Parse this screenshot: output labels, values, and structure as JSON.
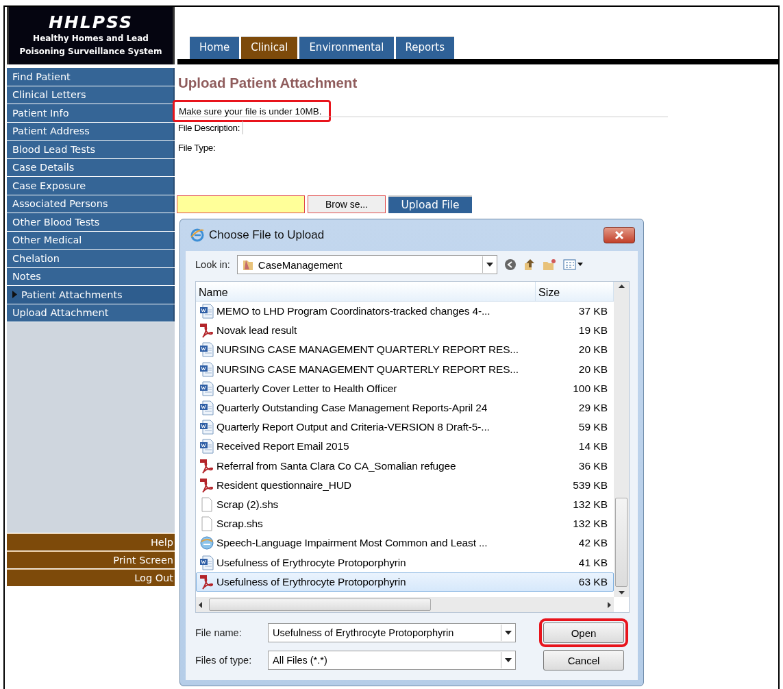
{
  "logo": {
    "title": "HHLPSS",
    "subtitle_1": "Healthy Homes and Lead",
    "subtitle_2": "Poisoning Surveillance System"
  },
  "tabs": [
    {
      "label": "Home",
      "selected": false
    },
    {
      "label": "Clinical",
      "selected": true
    },
    {
      "label": "Environmental",
      "selected": false
    },
    {
      "label": "Reports",
      "selected": false
    }
  ],
  "sidebar": {
    "items": [
      {
        "label": "Find Patient",
        "selected": false
      },
      {
        "label": "Clinical Letters",
        "selected": false
      },
      {
        "label": "Patient Info",
        "selected": false
      },
      {
        "label": "Patient Address",
        "selected": false
      },
      {
        "label": "Blood Lead Tests",
        "selected": false
      },
      {
        "label": "Case Details",
        "selected": false
      },
      {
        "label": "Case Exposure",
        "selected": false
      },
      {
        "label": "Associated Persons",
        "selected": false
      },
      {
        "label": "Other Blood Tests",
        "selected": false
      },
      {
        "label": "Other Medical",
        "selected": false
      },
      {
        "label": "Chelation",
        "selected": false
      },
      {
        "label": "Notes",
        "selected": false
      },
      {
        "label": "Patient Attachments",
        "selected": true
      },
      {
        "label": "Upload Attachment",
        "selected": false
      }
    ],
    "footer_items": [
      "Help",
      "Print Screen",
      "Log Out"
    ]
  },
  "page": {
    "title": "Upload Patient Attachment",
    "note": {
      "text": "Make sure your file is under 10MB.",
      "highlighted": true
    },
    "fields": [
      {
        "label": "File Description:",
        "kind": "input"
      },
      {
        "label": "File Type:",
        "kind": "plain"
      }
    ],
    "browse_button": "Brow se...",
    "upload_button": "Upload File"
  },
  "dialog": {
    "title": "Choose File to Upload",
    "look_in_label": "Look in:",
    "folder": "CaseManagement",
    "columns": [
      "Name",
      "Size"
    ],
    "files": [
      {
        "name": "MEMO to LHD Program Coordinators-tracked changes 4-...",
        "size": "37 KB",
        "kind": "word",
        "selected": false
      },
      {
        "name": "Novak lead result",
        "size": "19 KB",
        "kind": "pdf",
        "selected": false
      },
      {
        "name": "NURSING CASE MANAGEMENT QUARTERLY REPORT RES...",
        "size": "20 KB",
        "kind": "word",
        "selected": false
      },
      {
        "name": "NURSING CASE MANAGEMENT QUARTERLY REPORT RES...",
        "size": "20 KB",
        "kind": "word",
        "selected": false
      },
      {
        "name": "Quarterly Cover Letter to Health Officer",
        "size": "100 KB",
        "kind": "word",
        "selected": false
      },
      {
        "name": "Quarterly Outstanding Case Management Reports-April 24",
        "size": "29 KB",
        "kind": "word",
        "selected": false
      },
      {
        "name": "Quarterly Report Output and Criteria-VERSION 8 Draft-5-...",
        "size": "59 KB",
        "kind": "word",
        "selected": false
      },
      {
        "name": "Received Report Email 2015",
        "size": "14 KB",
        "kind": "word",
        "selected": false
      },
      {
        "name": "Referral from Santa Clara Co CA_Somalian refugee",
        "size": "36 KB",
        "kind": "pdf",
        "selected": false
      },
      {
        "name": "Resident questionnaire_HUD",
        "size": "539 KB",
        "kind": "pdf",
        "selected": false
      },
      {
        "name": "Scrap (2).shs",
        "size": "132 KB",
        "kind": "blank",
        "selected": false
      },
      {
        "name": "Scrap.shs",
        "size": "132 KB",
        "kind": "blank",
        "selected": false
      },
      {
        "name": "Speech-Language Impairment Most Common and Least ...",
        "size": "42 KB",
        "kind": "web",
        "selected": false
      },
      {
        "name": "Usefulness of Erythrocyte Protoporphyrin",
        "size": "41 KB",
        "kind": "word",
        "selected": false
      },
      {
        "name": "Usefulness of Erythrocyte Protoporphyrin",
        "size": "63 KB",
        "kind": "pdf",
        "selected": true
      }
    ],
    "file_name_label": "File name:",
    "file_name": "Usefulness of Erythrocyte Protoporphyrin",
    "file_type_label": "Files of type:",
    "file_type": "All Files (*.*)",
    "buttons": [
      {
        "label": "Open",
        "highlighted": true
      },
      {
        "label": "Cancel",
        "highlighted": false
      }
    ]
  }
}
